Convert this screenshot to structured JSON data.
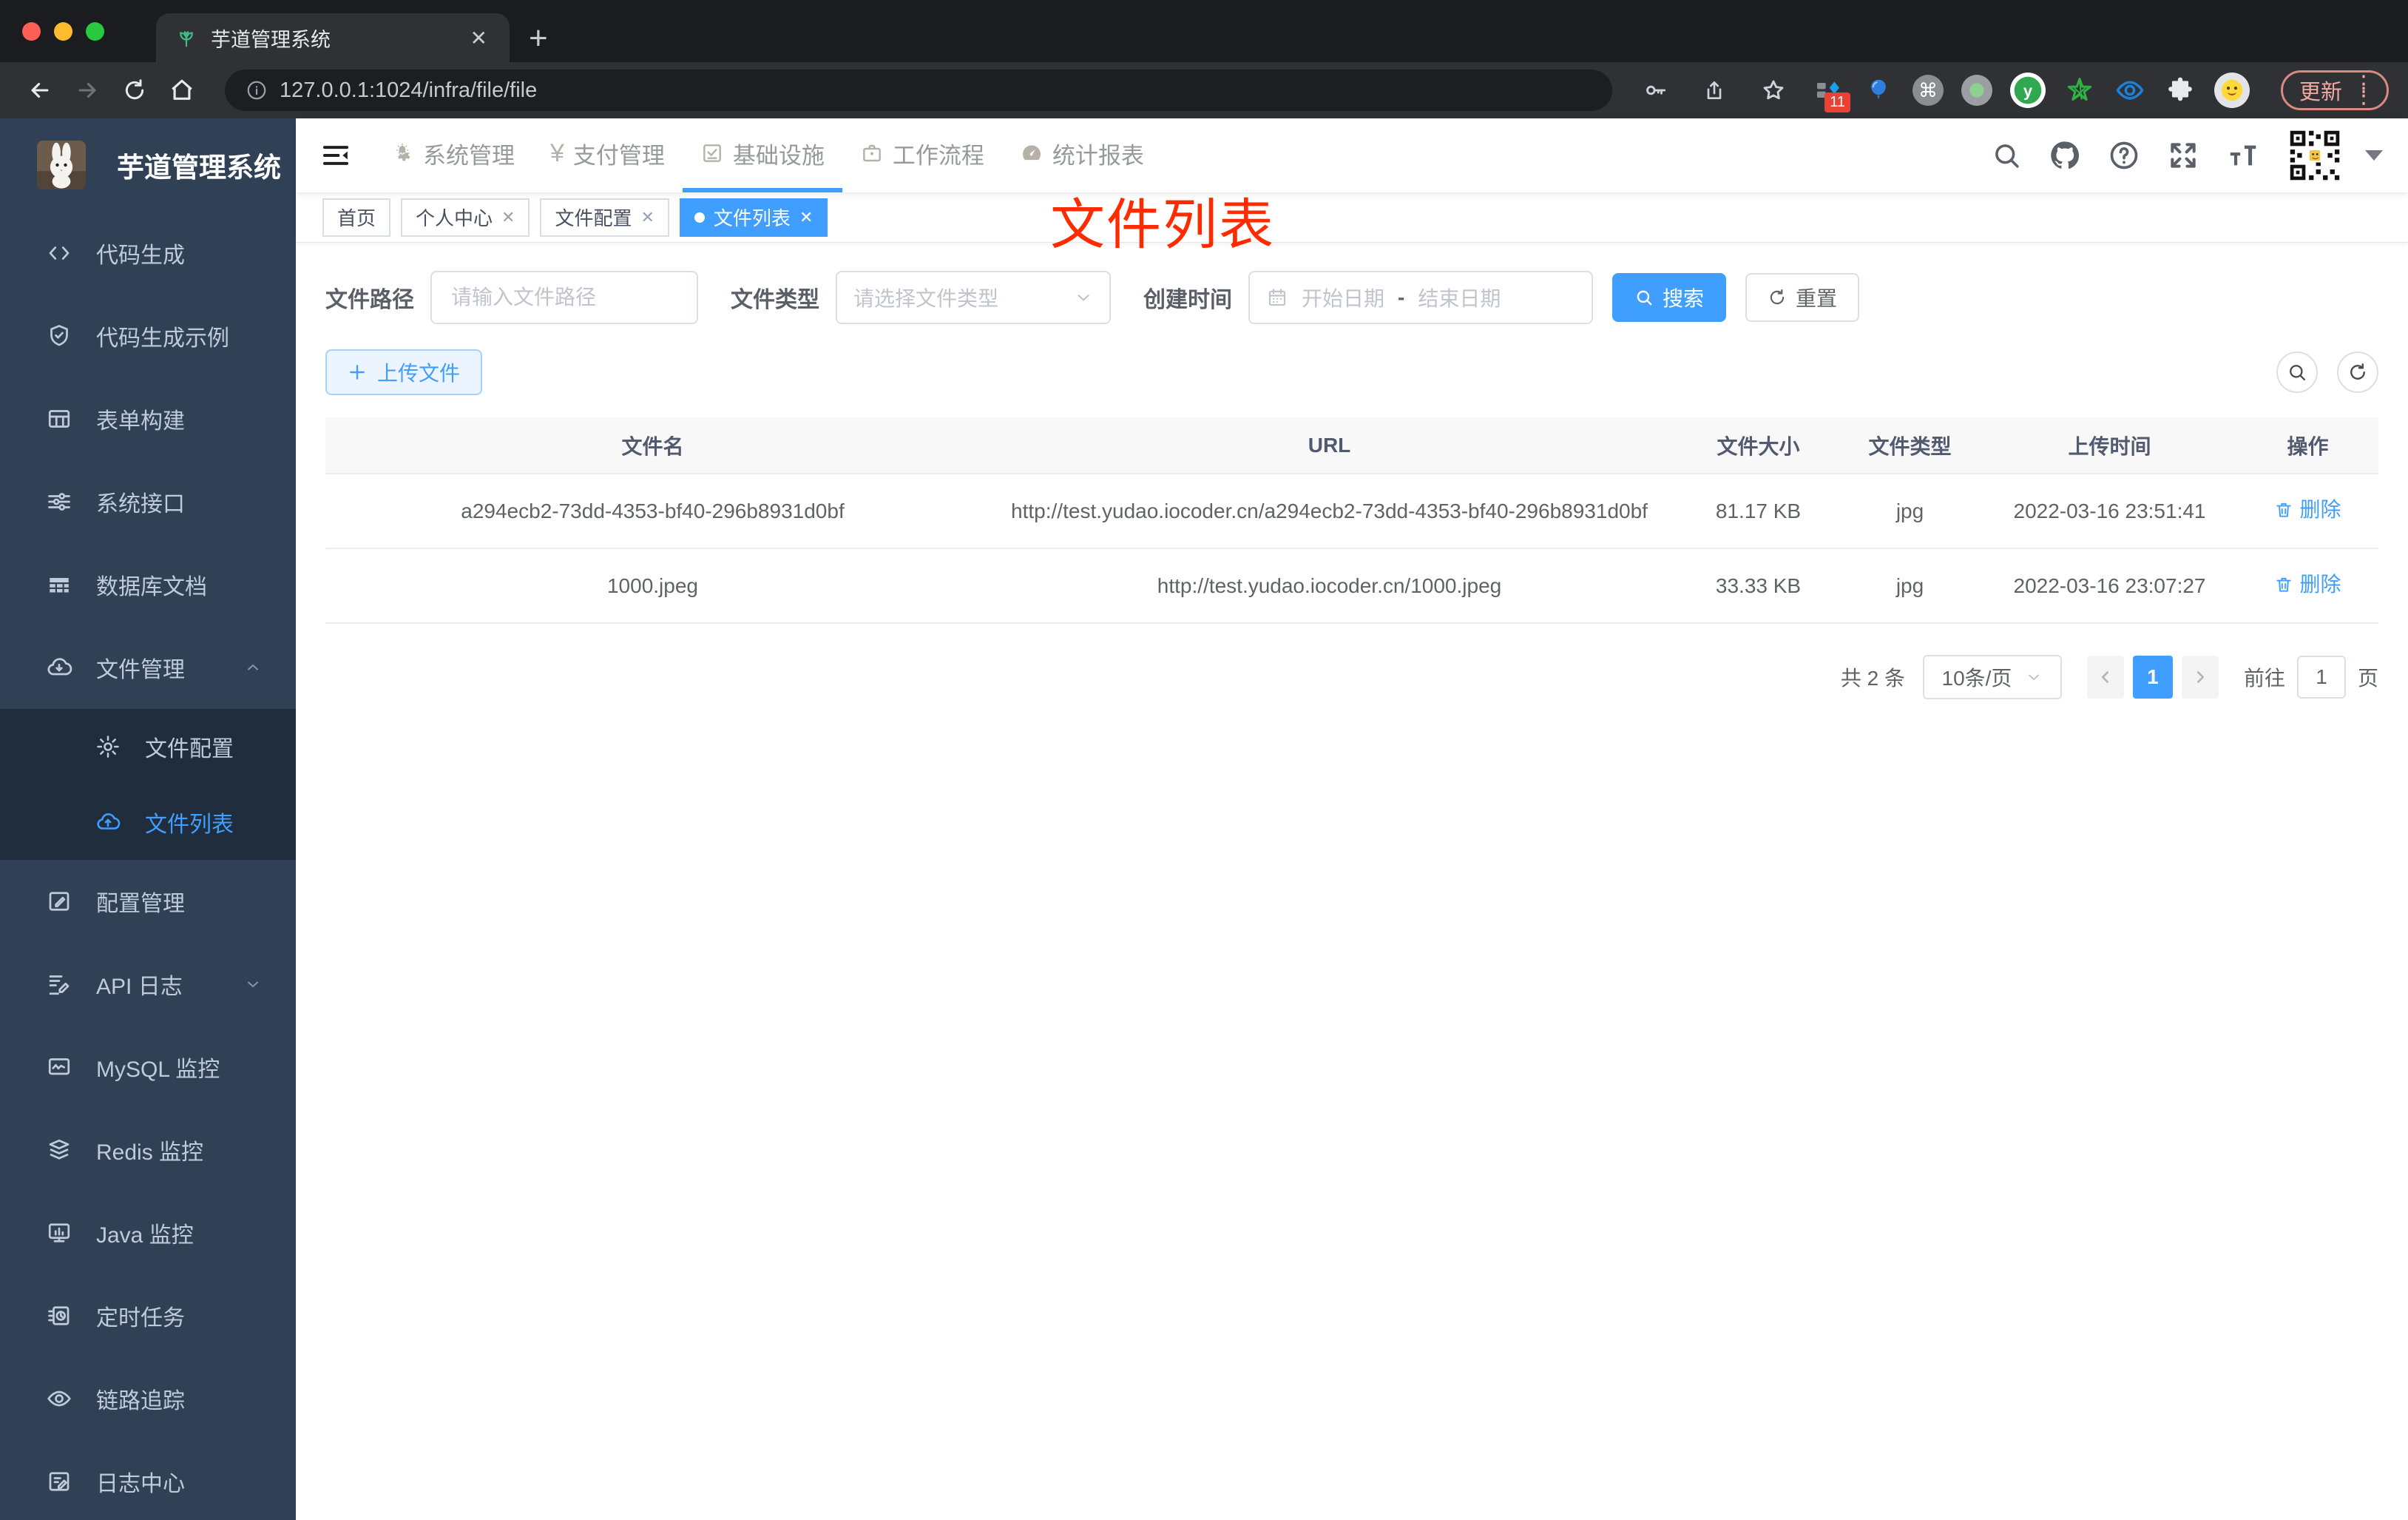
{
  "browser": {
    "tab_title": "芋道管理系统",
    "url": "127.0.0.1:1024/infra/file/file",
    "update_label": "更新",
    "extensions_badge": "11"
  },
  "icons": {
    "yen": "¥",
    "cmd": "⌘"
  },
  "sidebar": {
    "logo_title": "芋道管理系统",
    "items": [
      {
        "label": "代码生成"
      },
      {
        "label": "代码生成示例"
      },
      {
        "label": "表单构建"
      },
      {
        "label": "系统接口"
      },
      {
        "label": "数据库文档"
      },
      {
        "label": "文件管理",
        "expanded": true,
        "children": [
          {
            "label": "文件配置"
          },
          {
            "label": "文件列表",
            "active": true
          }
        ]
      },
      {
        "label": "配置管理"
      },
      {
        "label": "API 日志"
      },
      {
        "label": "MySQL 监控"
      },
      {
        "label": "Redis 监控"
      },
      {
        "label": "Java 监控"
      },
      {
        "label": "定时任务"
      },
      {
        "label": "链路追踪"
      },
      {
        "label": "日志中心"
      }
    ]
  },
  "topnav": {
    "items": [
      "系统管理",
      "支付管理",
      "基础设施",
      "工作流程",
      "统计报表"
    ],
    "active": "基础设施"
  },
  "tags": [
    {
      "label": "首页",
      "closable": false,
      "active": false
    },
    {
      "label": "个人中心",
      "closable": true,
      "active": false
    },
    {
      "label": "文件配置",
      "closable": true,
      "active": false
    },
    {
      "label": "文件列表",
      "closable": true,
      "active": true
    }
  ],
  "annotation": "文件列表",
  "filter": {
    "path_label": "文件路径",
    "path_placeholder": "请输入文件路径",
    "type_label": "文件类型",
    "type_placeholder": "请选择文件类型",
    "date_label": "创建时间",
    "date_start_placeholder": "开始日期",
    "date_separator": "-",
    "date_end_placeholder": "结束日期",
    "search_label": "搜索",
    "reset_label": "重置"
  },
  "toolbar": {
    "upload_label": "上传文件"
  },
  "table": {
    "headers": [
      "文件名",
      "URL",
      "文件大小",
      "文件类型",
      "上传时间",
      "操作"
    ],
    "rows": [
      {
        "name": "a294ecb2-73dd-4353-bf40-296b8931d0bf",
        "url": "http://test.yudao.iocoder.cn/a294ecb2-73dd-4353-bf40-296b8931d0bf",
        "size": "81.17 KB",
        "type": "jpg",
        "time": "2022-03-16 23:51:41",
        "action": "删除"
      },
      {
        "name": "1000.jpeg",
        "url": "http://test.yudao.iocoder.cn/1000.jpeg",
        "size": "33.33 KB",
        "type": "jpg",
        "time": "2022-03-16 23:07:27",
        "action": "删除"
      }
    ]
  },
  "pagination": {
    "total": "共 2 条",
    "page_size": "10条/页",
    "current_page": "1",
    "goto_label": "前往",
    "goto_value": "1",
    "page_unit": "页"
  },
  "colors": {
    "accent": "#409eff",
    "annotation_red": "#ff2b00",
    "sidebar_bg": "#304156",
    "submenu_bg": "#1f2d3d"
  }
}
